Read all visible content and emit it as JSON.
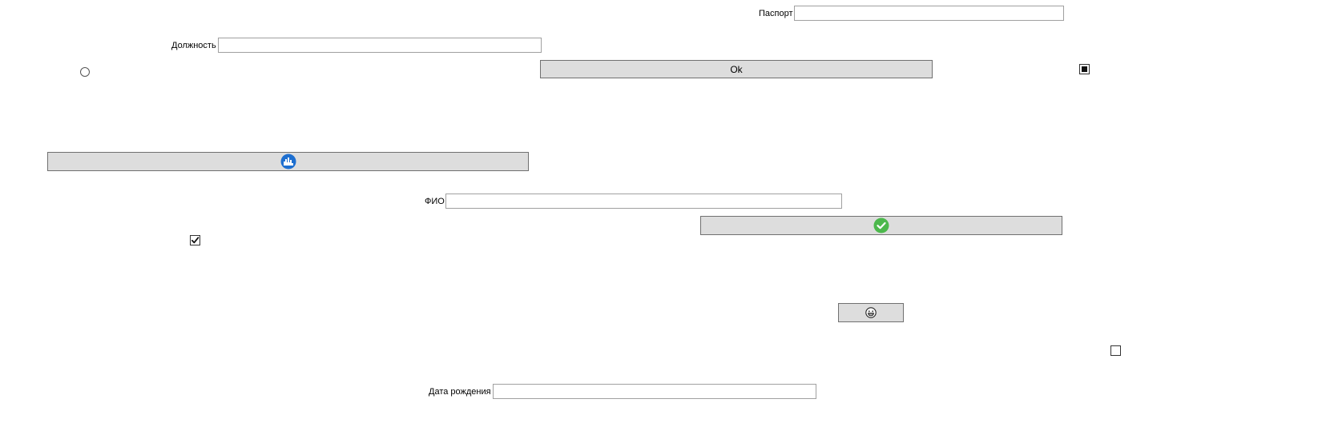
{
  "fields": {
    "passport": {
      "label": "Паспорт",
      "value": ""
    },
    "position": {
      "label": "Должность",
      "value": ""
    },
    "fio": {
      "label": "ФИО",
      "value": ""
    },
    "birth_date": {
      "label": "Дата рождения",
      "value": ""
    }
  },
  "buttons": {
    "ok": {
      "label": "Ok"
    },
    "city": {
      "icon": "city-skyline-icon",
      "color": "#1e6fd0"
    },
    "check": {
      "icon": "check-circle-icon",
      "color": "#4cb84c"
    },
    "emoji": {
      "icon": "grinning-face-icon"
    }
  },
  "controls": {
    "radio_1": {
      "checked": false
    },
    "checkbox_indeterminate": {
      "state": "indeterminate"
    },
    "checkbox_checked": {
      "state": "checked"
    },
    "checkbox_unchecked": {
      "state": "unchecked"
    }
  },
  "colors": {
    "button_bg": "#dddddd",
    "button_border": "#707070",
    "field_border": "#a0a0a0"
  }
}
